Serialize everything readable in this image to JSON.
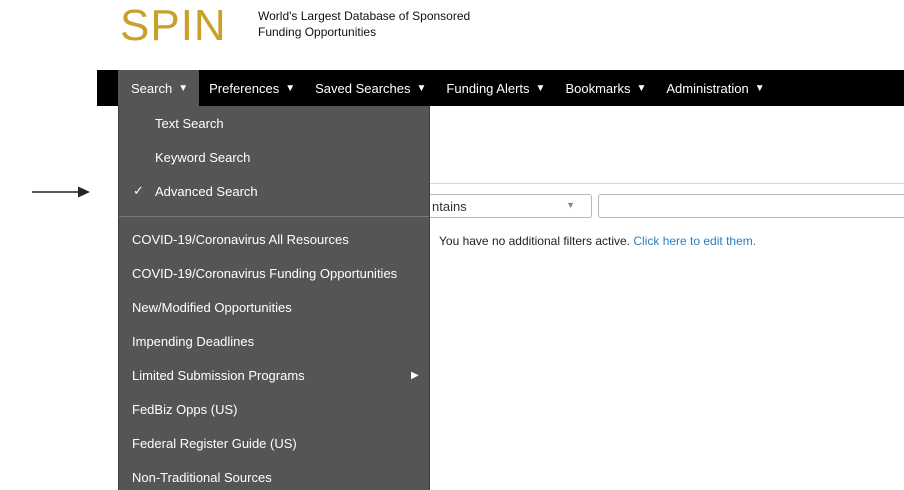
{
  "brand": {
    "logo_text": "SPIN",
    "tagline_line1": "World's Largest Database of Sponsored",
    "tagline_line2": "Funding Opportunities"
  },
  "nav": {
    "items": [
      {
        "label": "Search"
      },
      {
        "label": "Preferences"
      },
      {
        "label": "Saved Searches"
      },
      {
        "label": "Funding Alerts"
      },
      {
        "label": "Bookmarks"
      },
      {
        "label": "Administration"
      }
    ],
    "caret": "▼"
  },
  "search_menu": {
    "modes": [
      {
        "label": "Text Search"
      },
      {
        "label": "Keyword Search"
      },
      {
        "label": "Advanced Search",
        "checked_mark": "✓"
      }
    ],
    "resources": [
      {
        "label": "COVID-19/Coronavirus All Resources"
      },
      {
        "label": "COVID-19/Coronavirus Funding Opportunities"
      },
      {
        "label": "New/Modified Opportunities"
      },
      {
        "label": "Impending Deadlines"
      },
      {
        "label": "Limited Submission Programs",
        "submenu_arrow": "▶"
      },
      {
        "label": "FedBiz Opps (US)"
      },
      {
        "label": "Federal Register Guide (US)"
      },
      {
        "label": "Non-Traditional Sources"
      }
    ]
  },
  "filter": {
    "operator_value": "ntains",
    "select_caret": "▼",
    "text_value": "",
    "note_text": "You have no additional filters active. ",
    "note_link": "Click here to edit them."
  },
  "colors": {
    "brand_gold": "#c9a02a",
    "navbar_bg": "#000000",
    "menu_bg": "#555555",
    "link": "#2a7fc2"
  },
  "icons": {
    "pointer_arrow": "pointer-arrow-icon"
  }
}
